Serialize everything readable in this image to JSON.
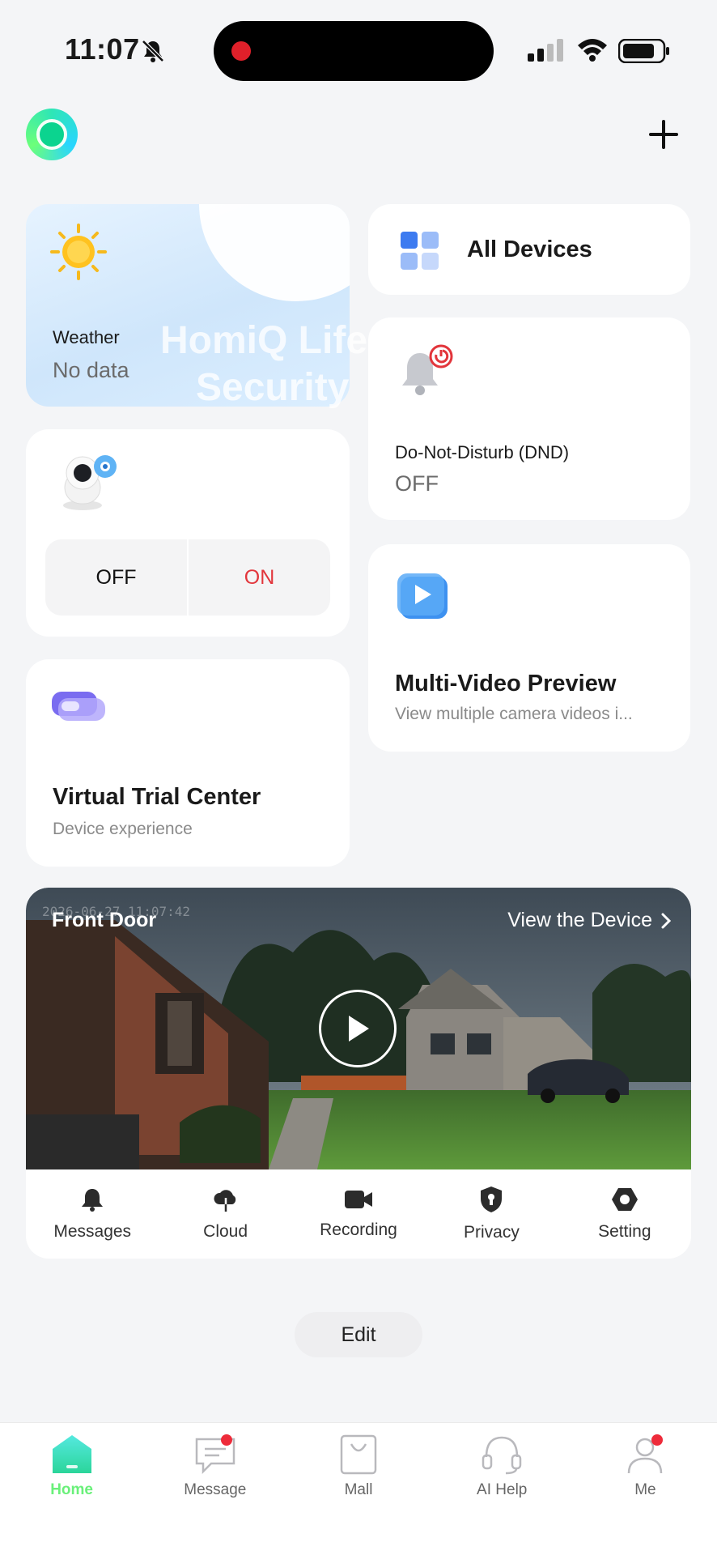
{
  "status_bar": {
    "time": "11:07"
  },
  "tiles": {
    "weather": {
      "label": "Weather",
      "value": "No data"
    },
    "all_devices": {
      "label": "All Devices"
    },
    "dnd": {
      "label": "Do-Not-Disturb (DND)",
      "value": "OFF"
    },
    "camera_toggle": {
      "off_label": "OFF",
      "on_label": "ON"
    },
    "multi_video": {
      "title": "Multi-Video Preview",
      "subtitle": "View multiple camera videos i..."
    },
    "virtual_trial": {
      "title": "Virtual Trial Center",
      "subtitle": "Device experience"
    }
  },
  "watermark": {
    "line1": "HomiQ Life",
    "line2": "Security"
  },
  "camera": {
    "timestamp": "2026-06-27 11:07:42",
    "name": "Front Door",
    "view_label": "View the Device",
    "actions": [
      "Messages",
      "Cloud",
      "Recording",
      "Privacy",
      "Setting"
    ]
  },
  "edit_label": "Edit",
  "tabbar": {
    "items": [
      "Home",
      "Message",
      "Mall",
      "AI Help",
      "Me"
    ],
    "active": "Home"
  },
  "colors": {
    "accent_green": "#6af07a",
    "alert_red": "#e2353b"
  }
}
